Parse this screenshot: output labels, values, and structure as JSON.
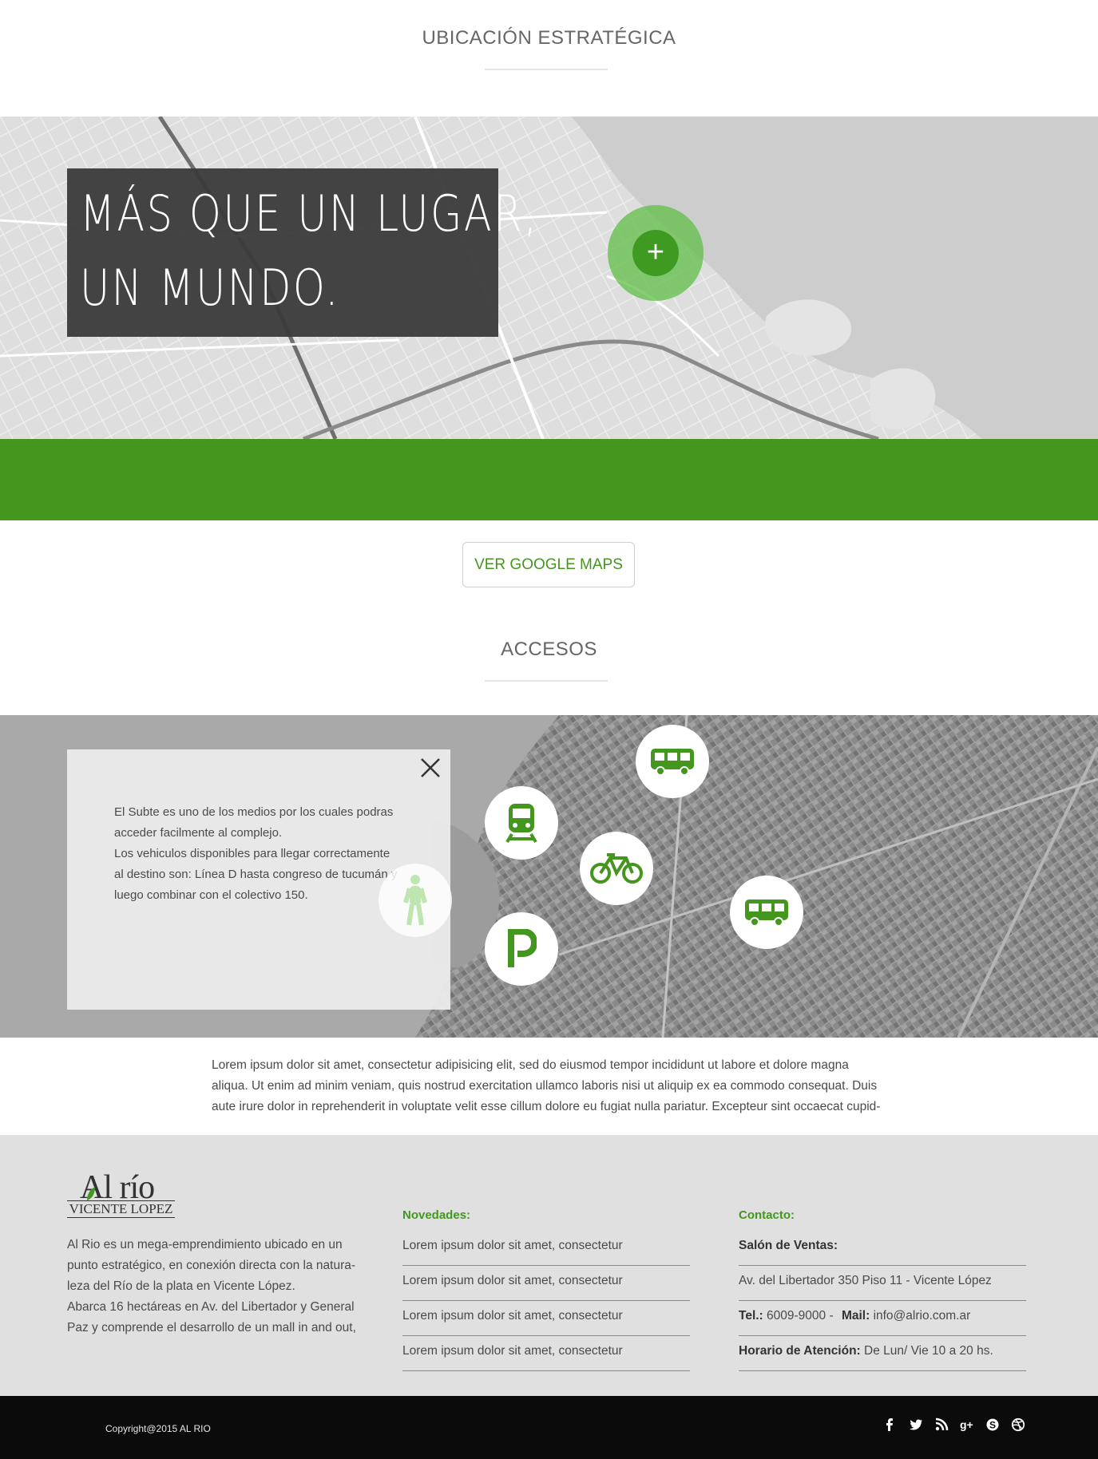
{
  "location": {
    "section_title": "UBICACIÓN ESTRATÉGICA",
    "hero_line_1": "MÁS QUE UN LUGAR,",
    "hero_line_2": "UN MUNDO.",
    "pin_symbol": "+",
    "gmaps_button": "VER GOOGLE MAPS"
  },
  "access": {
    "section_title": "ACCESOS",
    "info_lines": [
      "El Subte es uno de los medios por los cuales podras",
      "acceder facilmente al complejo.",
      "Los vehiculos disponibles para llegar correctamente",
      "al destino son: Línea D hasta congreso de tucumán y",
      "luego combinar con el colectivo 150."
    ],
    "transport_icons": [
      "bus-icon",
      "train-icon",
      "bicycle-icon",
      "walking-icon",
      "parking-icon",
      "bus-icon"
    ],
    "paragraph_lines": [
      "Lorem ipsum dolor sit amet, consectetur adipisicing elit, sed do eiusmod tempor incididunt ut labore et dolore magna",
      "aliqua. Ut enim ad minim veniam, quis nostrud exercitation ullamco laboris nisi ut aliquip ex ea commodo consequat. Duis",
      "aute irure dolor in reprehenderit in voluptate velit esse cillum dolore eu fugiat nulla pariatur. Excepteur sint occaecat cupid-"
    ]
  },
  "footer": {
    "logo_top": "Al río",
    "logo_bottom": "VICENTE LOPEZ",
    "about_lines": [
      "Al Rio es un mega-emprendimiento ubicado en un",
      "punto estratégico, en conexión directa con la natura-",
      "leza del Río de la plata en Vicente López.",
      "Abarca 16 hectáreas en Av. del Libertador y General",
      "Paz y comprende el desarrollo de un mall in and out,"
    ],
    "news_title": "Novedades:",
    "news_items": [
      "Lorem ipsum dolor sit amet, consectetur",
      "Lorem ipsum dolor sit amet, consectetur",
      "Lorem ipsum dolor sit amet, consectetur",
      "Lorem ipsum dolor sit amet, consectetur"
    ],
    "contact_title": "Contacto:",
    "contact": {
      "sales_label": "Salón de Ventas:",
      "address": "Av. del Libertador 350 Piso 11 - Vicente López",
      "tel_label": "Tel.:",
      "tel_value": "6009-9000 -",
      "mail_label": "Mail:",
      "mail_value": "info@alrio.com.ar",
      "hours_label": "Horario de Atención:",
      "hours_value": "De Lun/ Vie 10 a 20 hs."
    },
    "copyright": "Copyright@2015 AL RIO",
    "social_icons": [
      "facebook-icon",
      "twitter-icon",
      "rss-icon",
      "google-plus-icon",
      "skype-icon",
      "dribbble-icon"
    ]
  },
  "colors": {
    "accent_green": "#44961f",
    "dark_bar": "#0b0b0b",
    "footer_bg": "#e0e0e0"
  }
}
